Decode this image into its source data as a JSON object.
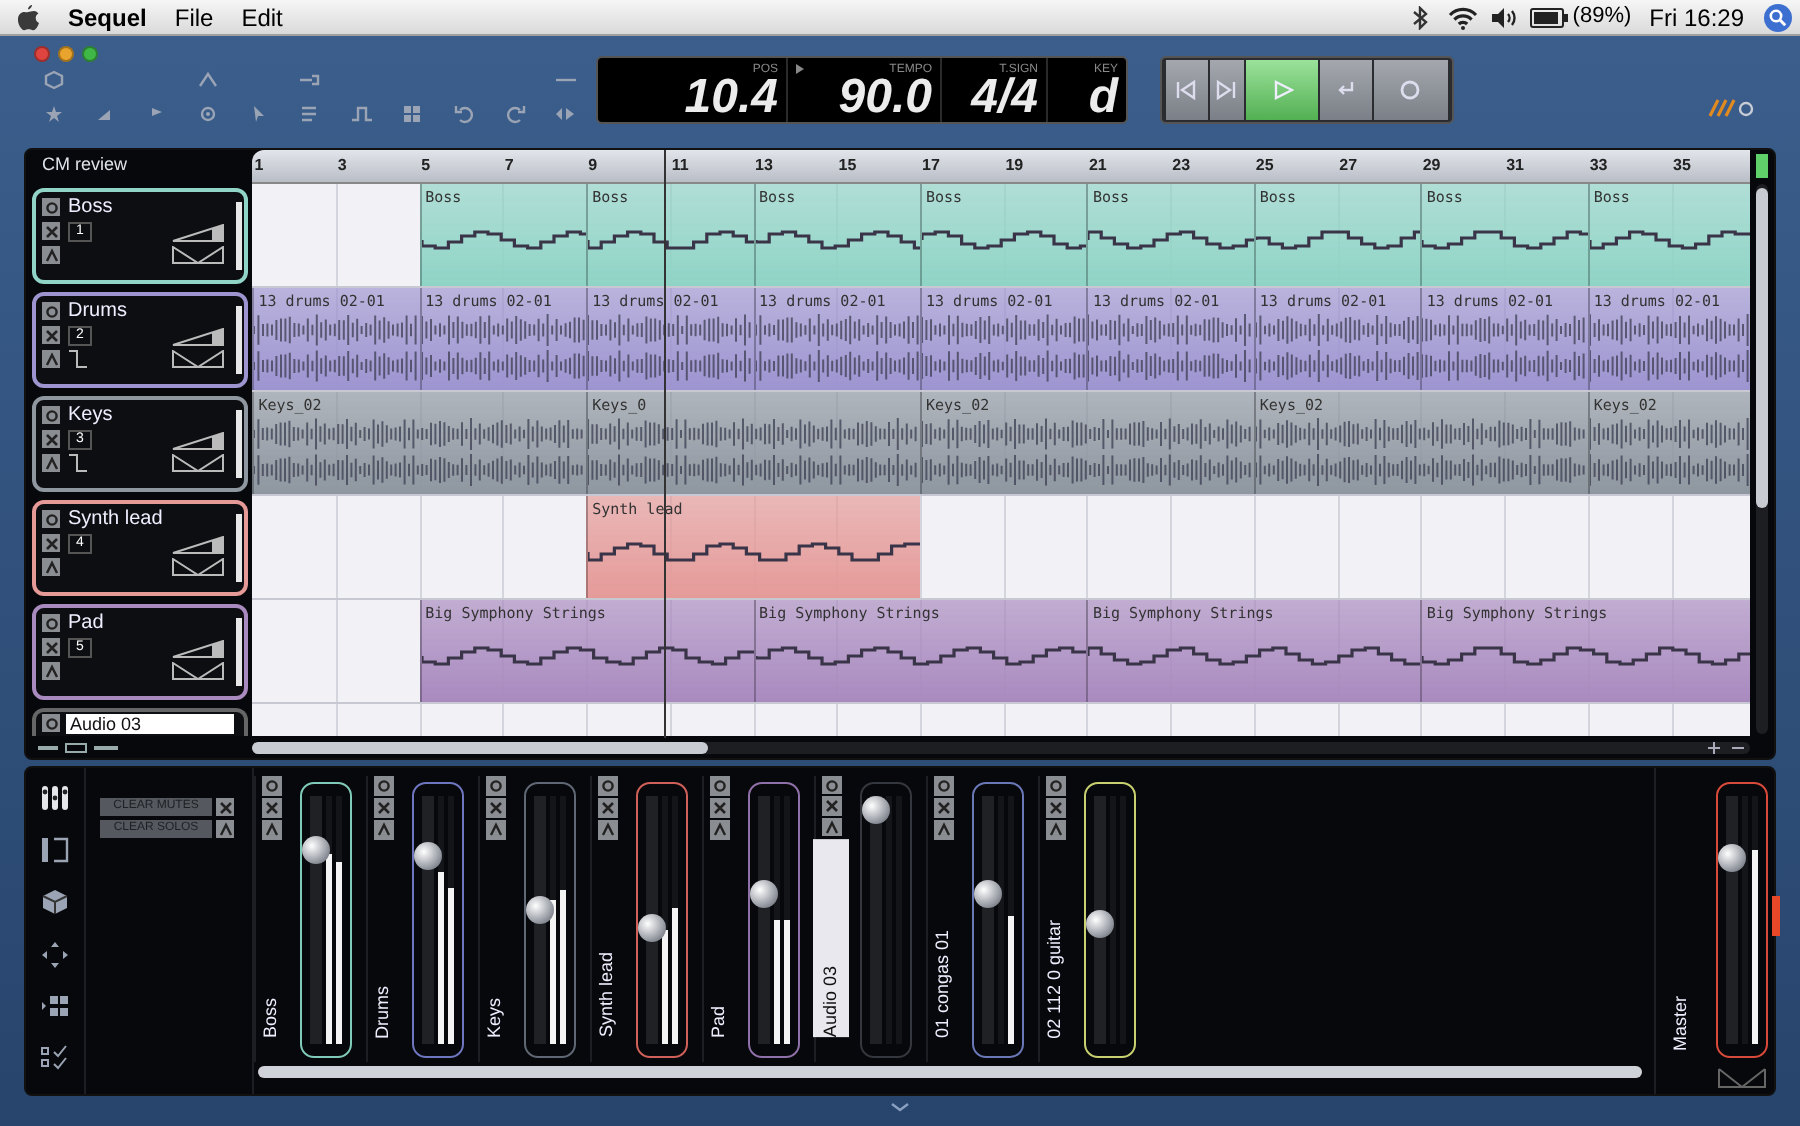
{
  "menubar": {
    "app_name": "Sequel",
    "menus": [
      "File",
      "Edit"
    ],
    "battery": "(89%)",
    "clock": "Fri 16:29"
  },
  "display": {
    "fields": [
      {
        "label": "POS",
        "value": "10.4"
      },
      {
        "label": "TEMPO",
        "value": "90.0"
      },
      {
        "label": "T.SIGN",
        "value": "4/4"
      },
      {
        "label": "KEY",
        "value": "d"
      }
    ]
  },
  "transport": [
    {
      "kind": "start",
      "selected": false
    },
    {
      "kind": "end",
      "selected": false
    },
    {
      "kind": "play",
      "selected": true
    },
    {
      "kind": "loop",
      "selected": false
    },
    {
      "kind": "record",
      "selected": false
    }
  ],
  "arrange": {
    "title": "CM review",
    "ruler": [
      "1",
      "3",
      "5",
      "7",
      "9",
      "11",
      "13",
      "15",
      "17",
      "19",
      "21",
      "23",
      "25",
      "27",
      "29",
      "31",
      "33",
      "35"
    ],
    "playhead": {
      "level": 0.275
    },
    "tracks": [
      {
        "name": "Boss",
        "number": "1",
        "kind": "instrument",
        "color": "#8fd4c6",
        "slots": [
          {
            "kind": "empty"
          },
          {
            "kind": "start",
            "label": "Boss"
          },
          {
            "kind": "start",
            "label": "Boss"
          },
          {
            "kind": "start",
            "label": "Boss"
          },
          {
            "kind": "start",
            "label": "Boss"
          },
          {
            "kind": "start",
            "label": "Boss"
          },
          {
            "kind": "start",
            "label": "Boss"
          },
          {
            "kind": "start",
            "label": "Boss"
          },
          {
            "kind": "start",
            "label": "Boss"
          }
        ]
      },
      {
        "name": "Drums",
        "number": "2",
        "kind": "audio",
        "color": "#9d94d0",
        "slots": [
          {
            "kind": "start",
            "label": "13 drums 02-01"
          },
          {
            "kind": "start",
            "label": "13 drums 02-01"
          },
          {
            "kind": "start",
            "label": "13 drums 02-01"
          },
          {
            "kind": "start",
            "label": "13 drums 02-01"
          },
          {
            "kind": "start",
            "label": "13 drums 02-01"
          },
          {
            "kind": "start",
            "label": "13 drums 02-01"
          },
          {
            "kind": "start",
            "label": "13 drums 02-01"
          },
          {
            "kind": "start",
            "label": "13 drums 02-01"
          },
          {
            "kind": "start",
            "label": "13 drums 02-01"
          }
        ]
      },
      {
        "name": "Keys",
        "number": "3",
        "kind": "audio",
        "color": "#8e969f",
        "slots": [
          {
            "kind": "start",
            "label": "Keys_02"
          },
          {
            "kind": "continue"
          },
          {
            "kind": "start",
            "label": "Keys_0"
          },
          {
            "kind": "continue"
          },
          {
            "kind": "start",
            "label": "Keys_02"
          },
          {
            "kind": "continue"
          },
          {
            "kind": "start",
            "label": "Keys_02"
          },
          {
            "kind": "continue"
          },
          {
            "kind": "start",
            "label": "Keys_02"
          }
        ]
      },
      {
        "name": "Synth lead",
        "number": "4",
        "kind": "instrument",
        "color": "#e59a98",
        "slots": [
          {
            "kind": "empty"
          },
          {
            "kind": "empty"
          },
          {
            "kind": "start",
            "label": "Synth lead"
          },
          {
            "kind": "continue"
          },
          {
            "kind": "empty"
          },
          {
            "kind": "empty"
          },
          {
            "kind": "empty"
          },
          {
            "kind": "empty"
          },
          {
            "kind": "empty"
          }
        ]
      },
      {
        "name": "Pad",
        "number": "5",
        "kind": "instrument",
        "color": "#a98abf",
        "slots": [
          {
            "kind": "empty"
          },
          {
            "kind": "start",
            "label": "Big Symphony Strings"
          },
          {
            "kind": "continue"
          },
          {
            "kind": "start",
            "label": "Big Symphony Strings"
          },
          {
            "kind": "continue"
          },
          {
            "kind": "start",
            "label": "Big Symphony Strings"
          },
          {
            "kind": "continue"
          },
          {
            "kind": "start",
            "label": "Big Symphony Strings"
          },
          {
            "kind": "continue"
          }
        ]
      }
    ],
    "partial_track": {
      "name": "Audio 03",
      "selected": true
    }
  },
  "mixer": {
    "clear_buttons": [
      {
        "label": "CLEAR MUTES",
        "kind": "mute"
      },
      {
        "label": "CLEAR SOLOS",
        "kind": "solo"
      }
    ],
    "channels": [
      {
        "name": "Boss",
        "color": "#7fcab8",
        "selected": false,
        "level": 0.82,
        "meters": [
          {
            "level": 0.77
          },
          {
            "level": 0.73
          }
        ]
      },
      {
        "name": "Drums",
        "color": "#6f76c0",
        "selected": false,
        "level": 0.79,
        "meters": [
          {
            "level": 0.69
          },
          {
            "level": 0.63
          }
        ]
      },
      {
        "name": "Keys",
        "color": "#5f6874",
        "selected": false,
        "level": 0.55,
        "meters": [
          {
            "level": 0.58
          },
          {
            "level": 0.62
          }
        ]
      },
      {
        "name": "Synth lead",
        "color": "#d0605a",
        "selected": false,
        "level": 0.46,
        "meters": [
          {
            "level": 0.46
          },
          {
            "level": 0.55
          }
        ]
      },
      {
        "name": "Pad",
        "color": "#9070a8",
        "selected": false,
        "level": 0.62,
        "meters": [
          {
            "level": 0.5
          },
          {
            "level": 0.5
          }
        ]
      },
      {
        "name": "Audio 03",
        "color": "#34373d",
        "selected": true,
        "level": 1,
        "meters": [
          {
            "level": 0
          },
          {
            "level": 0
          }
        ]
      },
      {
        "name": "01 congas 01",
        "color": "#6a78b8",
        "selected": false,
        "level": 0.62,
        "meters": [
          {
            "level": 0
          },
          {
            "level": 0.52
          }
        ]
      },
      {
        "name": "02 112 0 guitar",
        "color": "#c8d070",
        "selected": false,
        "level": 0.48,
        "meters": [
          {
            "level": 0
          },
          {
            "level": 0
          }
        ]
      }
    ],
    "master": {
      "name": "Master",
      "color": "#d84a3a",
      "level": 0.78,
      "meters": [
        {
          "level": 0
        },
        {
          "level": 0.78
        }
      ],
      "clipped": true
    }
  }
}
